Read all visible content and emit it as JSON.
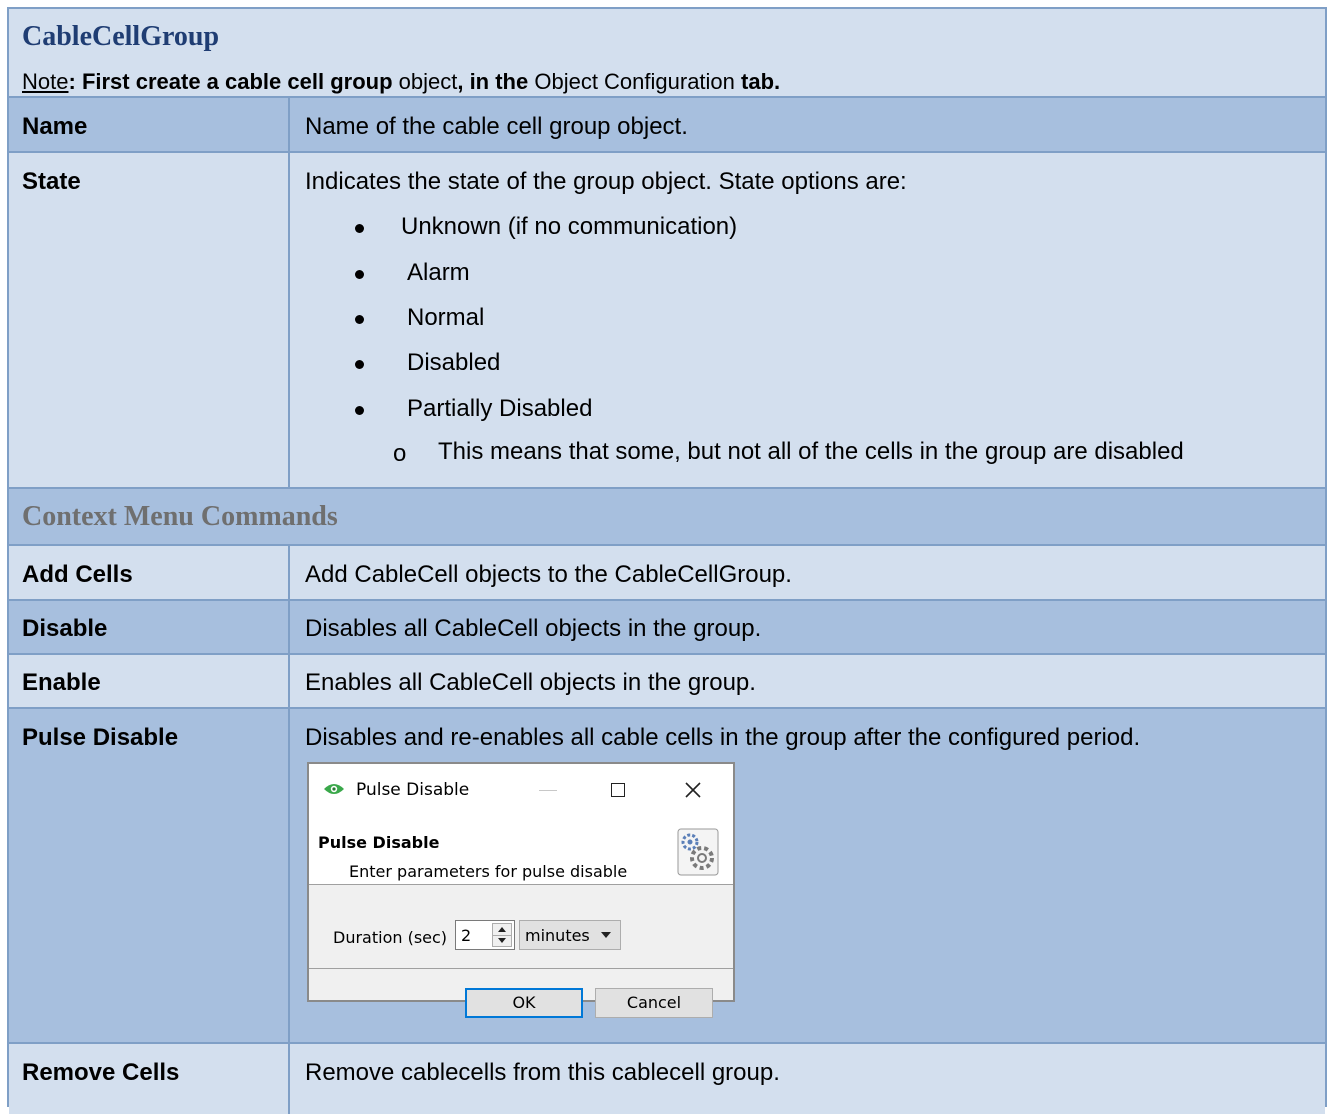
{
  "section_title": "CableCellGroup",
  "note": {
    "prefix": "Note",
    "colon": ": ",
    "part1": "First create a cable cell group",
    "part2": " object",
    "part3": ", in the",
    "part4": " Object Configuration ",
    "part5": "tab."
  },
  "rows": {
    "name": {
      "label": "Name",
      "desc": "Name of the cable cell group object."
    },
    "state": {
      "label": "State",
      "desc": "Indicates the state of the group object. State options are:",
      "options": [
        "Unknown (if no communication)",
        "Alarm",
        "Normal",
        "Disabled",
        "Partially Disabled"
      ],
      "sub_marker": "o",
      "sub_option": "This means that some, but not all of the cells in the group are disabled"
    }
  },
  "context_heading": "Context Menu Commands",
  "commands": {
    "add": {
      "label": "Add Cells",
      "desc": "Add CableCell objects to the CableCellGroup."
    },
    "disable": {
      "label": "Disable",
      "desc": "Disables all CableCell objects in the group."
    },
    "enable": {
      "label": "Enable",
      "desc": "Enables all CableCell objects in the group."
    },
    "pulse": {
      "label": "Pulse Disable",
      "desc": "Disables and re-enables all cable cells in the group after the configured period."
    },
    "remove": {
      "label": "Remove Cells",
      "desc": "Remove cablecells from this cablecell group."
    }
  },
  "dialog": {
    "title": "Pulse Disable",
    "header": "Pulse Disable",
    "subheader": "Enter parameters for pulse disable",
    "duration_label": "Duration (sec)",
    "duration_value": "2",
    "unit": "minutes",
    "ok": "OK",
    "cancel": "Cancel"
  },
  "colors": {
    "light_row": "#d3dfee",
    "dark_row": "#a7bfde",
    "border": "#7f9fc6",
    "heading_blue": "#1f3d73",
    "heading_gray": "#6f6f6f"
  }
}
